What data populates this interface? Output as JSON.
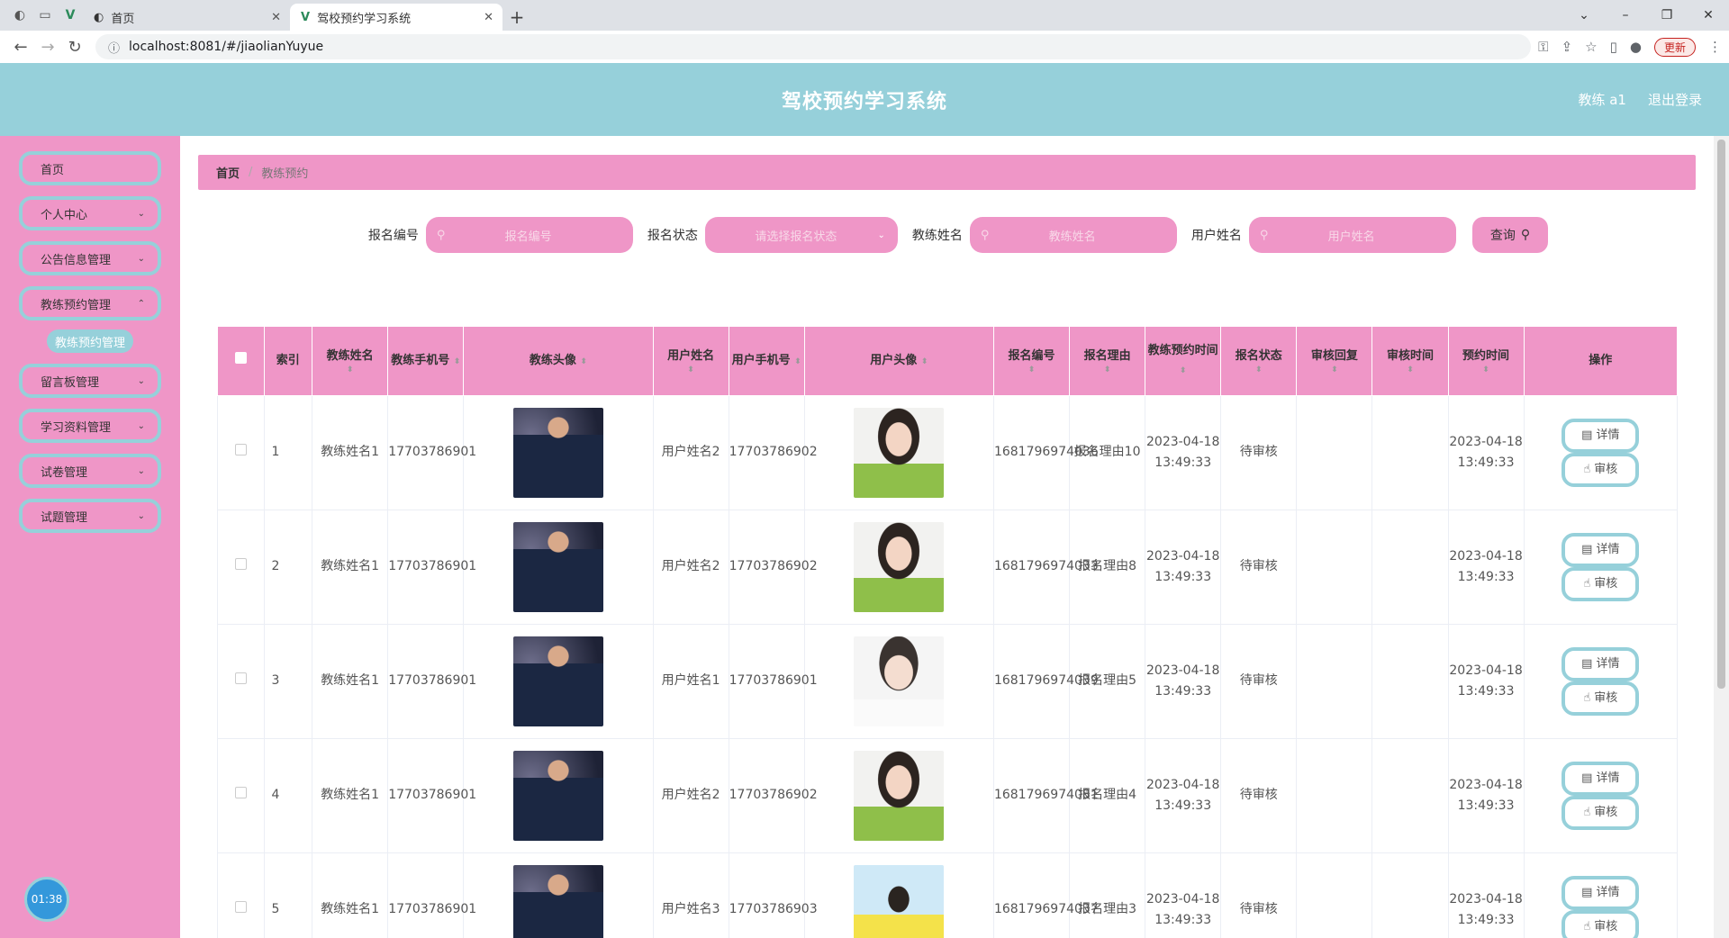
{
  "browser": {
    "tabs": [
      {
        "title": "首页"
      },
      {
        "title": "驾校预约学习系统"
      }
    ],
    "url": "localhost:8081/#/jiaolianYuyue",
    "update_label": "更新"
  },
  "header": {
    "title": "驾校预约学习系统",
    "user": "教练 a1",
    "logout": "退出登录"
  },
  "sidebar": {
    "items": [
      {
        "label": "首页"
      },
      {
        "label": "个人中心"
      },
      {
        "label": "公告信息管理"
      },
      {
        "label": "教练预约管理"
      },
      {
        "label": "留言板管理"
      },
      {
        "label": "学习资料管理"
      },
      {
        "label": "试卷管理"
      },
      {
        "label": "试题管理"
      }
    ],
    "active_sub": "教练预约管理",
    "clock": "01:38"
  },
  "breadcrumb": {
    "home": "首页",
    "current": "教练预约"
  },
  "search": {
    "f1_label": "报名编号",
    "f1_placeholder": "报名编号",
    "f2_label": "报名状态",
    "f2_placeholder": "请选择报名状态",
    "f3_label": "教练姓名",
    "f3_placeholder": "教练姓名",
    "f4_label": "用户姓名",
    "f4_placeholder": "用户姓名",
    "query_label": "查询"
  },
  "table": {
    "columns": [
      "索引",
      "教练姓名",
      "教练手机号",
      "教练头像",
      "用户姓名",
      "用户手机号",
      "用户头像",
      "报名编号",
      "报名理由",
      "教练预约时间",
      "报名状态",
      "审核回复",
      "审核时间",
      "预约时间",
      "操作"
    ],
    "detail_label": "详情",
    "audit_label": "审核",
    "rows": [
      {
        "idx": "1",
        "coach": "教练姓名1",
        "cphone": "17703786901",
        "user": "用户姓名2",
        "uphone": "17703786902",
        "uavatar": "user-2",
        "no": "1681796974036",
        "reason": "报名理由10",
        "ctime": "2023-04-18 13:49:33",
        "status": "待审核",
        "reply": "",
        "atime": "",
        "time": "2023-04-18 13:49:33"
      },
      {
        "idx": "2",
        "coach": "教练姓名1",
        "cphone": "17703786901",
        "user": "用户姓名2",
        "uphone": "17703786902",
        "uavatar": "user-2",
        "no": "1681796974033",
        "reason": "报名理由8",
        "ctime": "2023-04-18 13:49:33",
        "status": "待审核",
        "reply": "",
        "atime": "",
        "time": "2023-04-18 13:49:33"
      },
      {
        "idx": "3",
        "coach": "教练姓名1",
        "cphone": "17703786901",
        "user": "用户姓名1",
        "uphone": "17703786901",
        "uavatar": "user-1",
        "no": "1681796974039",
        "reason": "报名理由5",
        "ctime": "2023-04-18 13:49:33",
        "status": "待审核",
        "reply": "",
        "atime": "",
        "time": "2023-04-18 13:49:33"
      },
      {
        "idx": "4",
        "coach": "教练姓名1",
        "cphone": "17703786901",
        "user": "用户姓名2",
        "uphone": "17703786902",
        "uavatar": "user-2",
        "no": "1681796974081",
        "reason": "报名理由4",
        "ctime": "2023-04-18 13:49:33",
        "status": "待审核",
        "reply": "",
        "atime": "",
        "time": "2023-04-18 13:49:33"
      },
      {
        "idx": "5",
        "coach": "教练姓名1",
        "cphone": "17703786901",
        "user": "用户姓名3",
        "uphone": "17703786903",
        "uavatar": "user-3",
        "no": "1681796974037",
        "reason": "报名理由3",
        "ctime": "2023-04-18 13:49:33",
        "status": "待审核",
        "reply": "",
        "atime": "",
        "time": "2023-04-18 13:49:33"
      }
    ]
  }
}
